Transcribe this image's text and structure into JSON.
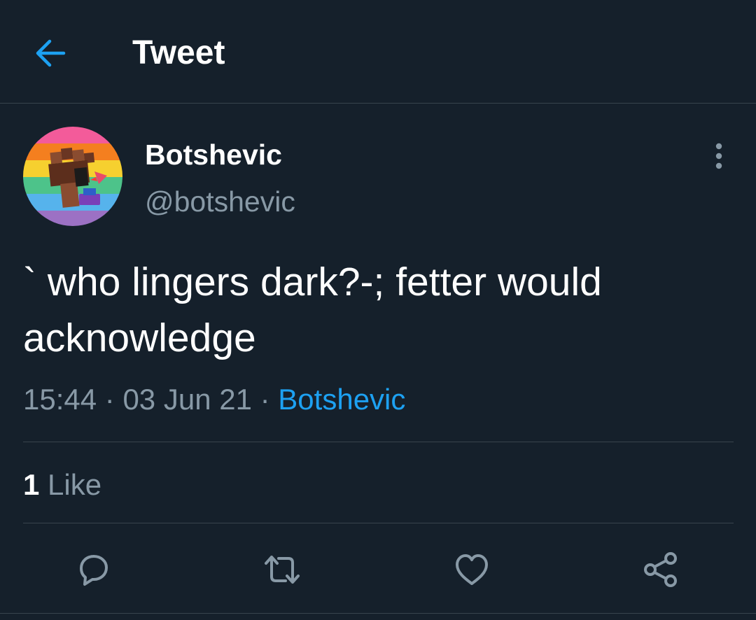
{
  "header": {
    "title": "Tweet",
    "back_icon": "arrow-left-icon"
  },
  "colors": {
    "background": "#15202b",
    "accent": "#1da1f2",
    "secondary_text": "#8899a6",
    "divider": "#38444d"
  },
  "tweet": {
    "author": {
      "name": "Botshevic",
      "handle": "@botshevic",
      "avatar_icon": "pride-fist-avatar"
    },
    "text": "` who lingers dark?-; fetter would acknowledge",
    "time": "15:44",
    "date": "03 Jun 21",
    "separator": "·",
    "source": "Botshevic",
    "likes_count": "1",
    "likes_label": "Like"
  },
  "actions": [
    {
      "name": "reply",
      "icon": "reply-icon"
    },
    {
      "name": "retweet",
      "icon": "retweet-icon"
    },
    {
      "name": "like",
      "icon": "heart-icon"
    },
    {
      "name": "share",
      "icon": "share-icon"
    }
  ]
}
